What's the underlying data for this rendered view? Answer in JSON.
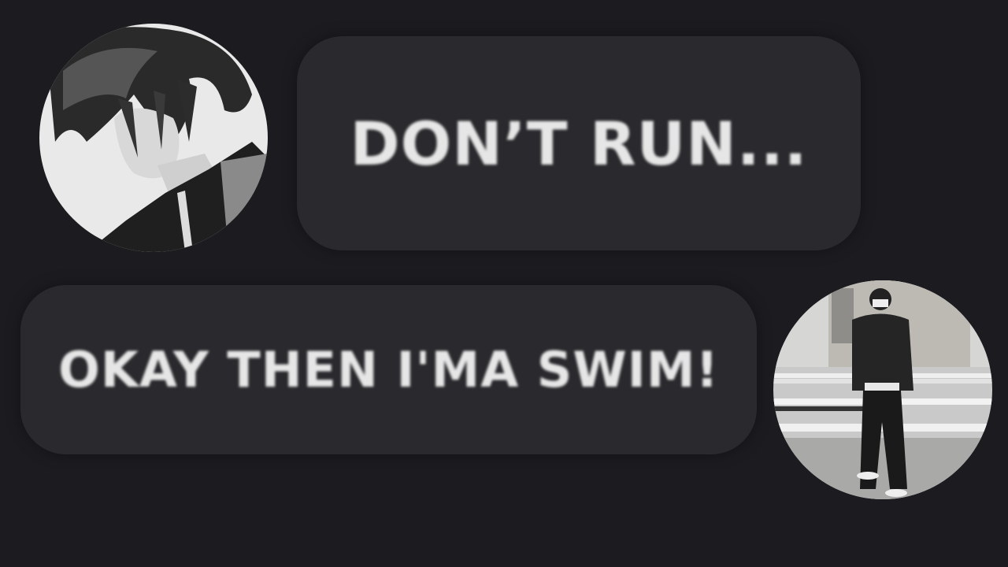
{
  "conversation": {
    "messages": [
      {
        "text": "DON’T RUN...",
        "sender": "left",
        "avatar": "anime-boy-avatar"
      },
      {
        "text": "OKAY THEN I'MA SWIM!",
        "sender": "right",
        "avatar": "street-photo-avatar"
      }
    ]
  },
  "colors": {
    "background": "#1c1b20",
    "bubble": "#2a2a2e",
    "text": "#e6e6e6"
  }
}
